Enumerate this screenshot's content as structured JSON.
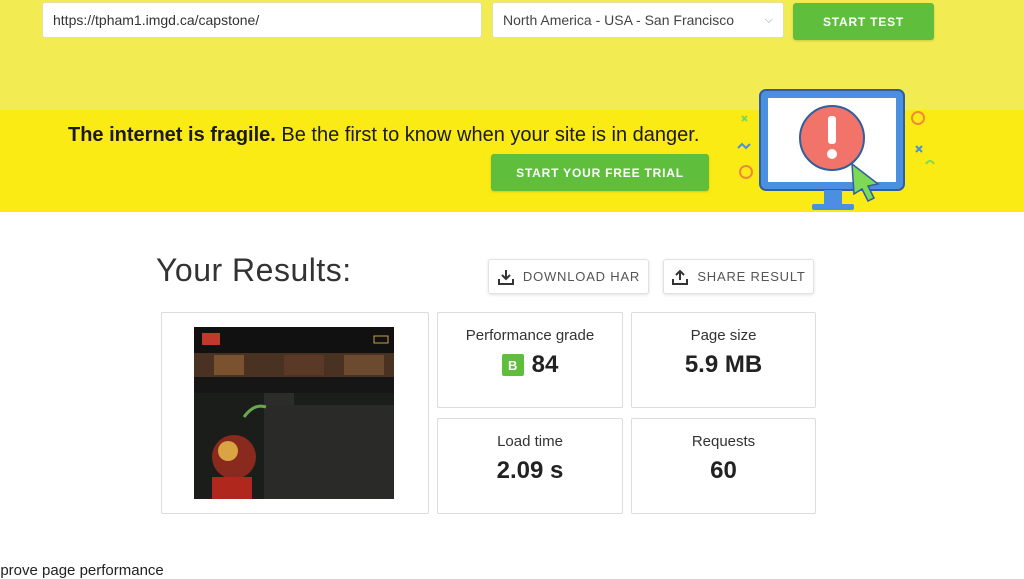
{
  "search": {
    "url_value": "https://tpham1.imgd.ca/capstone/",
    "location": "North America - USA - San Francisco",
    "start_label": "START TEST"
  },
  "promo": {
    "headline_bold": "The internet is fragile.",
    "headline_rest": " Be the first to know when your site is in danger.",
    "trial_label": "START YOUR FREE TRIAL"
  },
  "results": {
    "title": "Your Results:",
    "download_label": "DOWNLOAD HAR",
    "share_label": "SHARE RESULT"
  },
  "metrics": {
    "performance_grade": {
      "label": "Performance grade",
      "grade": "B",
      "value": "84"
    },
    "page_size": {
      "label": "Page size",
      "value": "5.9 MB"
    },
    "load_time": {
      "label": "Load time",
      "value": "2.09 s"
    },
    "requests": {
      "label": "Requests",
      "value": "60"
    }
  },
  "bottom": {
    "text": "nprove page performance"
  },
  "colors": {
    "accent_green": "#5fbf3d",
    "promo_yellow": "#fbeb14",
    "top_yellow": "#f2ec52"
  }
}
